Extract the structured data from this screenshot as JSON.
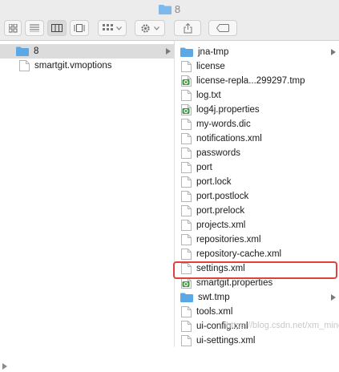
{
  "window": {
    "title": "8"
  },
  "left_column": {
    "items": [
      {
        "label": "8",
        "kind": "folder",
        "selected": true
      },
      {
        "label": "smartgit.vmoptions",
        "kind": "file"
      }
    ]
  },
  "right_column": {
    "items": [
      {
        "label": "jna-tmp",
        "kind": "folder",
        "arrow": true
      },
      {
        "label": "license",
        "kind": "file"
      },
      {
        "label": "license-repla...299297.tmp",
        "kind": "green"
      },
      {
        "label": "log.txt",
        "kind": "file"
      },
      {
        "label": "log4j.properties",
        "kind": "green"
      },
      {
        "label": "my-words.dic",
        "kind": "file"
      },
      {
        "label": "notifications.xml",
        "kind": "file"
      },
      {
        "label": "passwords",
        "kind": "file"
      },
      {
        "label": "port",
        "kind": "file"
      },
      {
        "label": "port.lock",
        "kind": "file"
      },
      {
        "label": "port.postlock",
        "kind": "file"
      },
      {
        "label": "port.prelock",
        "kind": "file"
      },
      {
        "label": "projects.xml",
        "kind": "file"
      },
      {
        "label": "repositories.xml",
        "kind": "file"
      },
      {
        "label": "repository-cache.xml",
        "kind": "file"
      },
      {
        "label": "settings.xml",
        "kind": "file",
        "highlighted": true
      },
      {
        "label": "smartgit.properties",
        "kind": "green"
      },
      {
        "label": "swt.tmp",
        "kind": "folder",
        "arrow": true
      },
      {
        "label": "tools.xml",
        "kind": "file"
      },
      {
        "label": "ui-config.xml",
        "kind": "file"
      },
      {
        "label": "ui-settings.xml",
        "kind": "file"
      }
    ]
  },
  "watermark": "https://blog.csdn.net/xm_miner",
  "colors": {
    "folder": "#5aa9e6",
    "highlight": "#e0413a",
    "green_badge": "#3a9a3a"
  }
}
